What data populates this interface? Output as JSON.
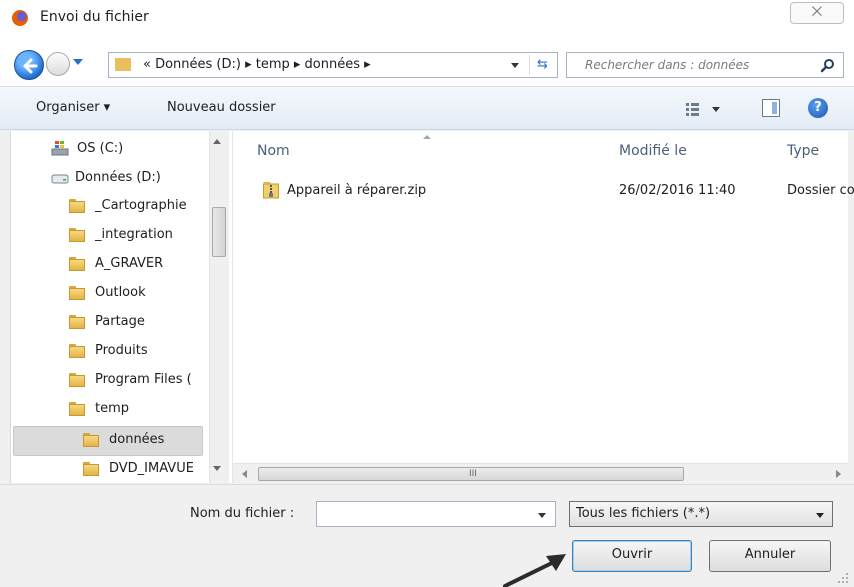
{
  "window": {
    "title": "Envoi du fichier",
    "close_glyph": "⨉"
  },
  "nav": {
    "address_text": "« Données (D:)  ▸  temp  ▸  données  ▸",
    "search_placeholder": "Rechercher dans : données",
    "refresh_glyph": "⇆"
  },
  "toolbar": {
    "organise_label": "Organiser ▾",
    "new_folder_label": "Nouveau dossier",
    "help_glyph": "?"
  },
  "tree": {
    "items": [
      {
        "label": "OS (C:)",
        "type": "drive-c"
      },
      {
        "label": "Données (D:)",
        "type": "drive"
      },
      {
        "label": "_Cartographie",
        "type": "folder"
      },
      {
        "label": "_integration",
        "type": "folder"
      },
      {
        "label": "A_GRAVER",
        "type": "folder"
      },
      {
        "label": "Outlook",
        "type": "folder"
      },
      {
        "label": "Partage",
        "type": "folder"
      },
      {
        "label": "Produits",
        "type": "folder"
      },
      {
        "label": "Program Files (",
        "type": "folder"
      },
      {
        "label": "temp",
        "type": "folder"
      },
      {
        "label": "données",
        "type": "folder",
        "selected": true
      },
      {
        "label": "DVD_IMAVUE",
        "type": "folder"
      }
    ]
  },
  "files": {
    "columns": {
      "name": "Nom",
      "modified": "Modifié le",
      "type": "Type"
    },
    "rows": [
      {
        "name": "Appareil à réparer.zip",
        "modified": "26/02/2016 11:40",
        "type": "Dossier co"
      }
    ],
    "hscroll_grip": "III"
  },
  "bottom": {
    "filename_label": "Nom du fichier :",
    "filename_value": "",
    "filter_value": "Tous les fichiers (*.*)",
    "open_label": "Ouvrir",
    "cancel_label": "Annuler"
  }
}
